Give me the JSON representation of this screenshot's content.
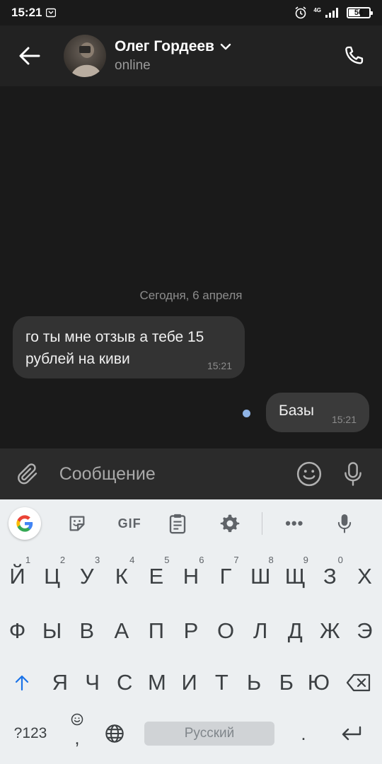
{
  "status_bar": {
    "time": "15:21",
    "network": "4G",
    "battery": "56",
    "battery_level": 0.56
  },
  "header": {
    "contact_name": "Олег Гордеев",
    "contact_status": "online"
  },
  "chat": {
    "date_separator": "Сегодня, 6 апреля",
    "messages": [
      {
        "direction": "incoming",
        "text": "го ты мне отзыв а тебе 15 рублей на киви",
        "time": "15:21"
      },
      {
        "direction": "outgoing",
        "text": "Базы",
        "time": "15:21",
        "read": false
      }
    ]
  },
  "composer": {
    "placeholder": "Сообщение"
  },
  "keyboard": {
    "toolbar": {
      "gif_label": "GIF",
      "more_label": "•••"
    },
    "rows": [
      [
        {
          "label": "Й",
          "hint": "1"
        },
        {
          "label": "Ц",
          "hint": "2"
        },
        {
          "label": "У",
          "hint": "3"
        },
        {
          "label": "К",
          "hint": "4"
        },
        {
          "label": "Е",
          "hint": "5"
        },
        {
          "label": "Н",
          "hint": "6"
        },
        {
          "label": "Г",
          "hint": "7"
        },
        {
          "label": "Ш",
          "hint": "8"
        },
        {
          "label": "Щ",
          "hint": "9"
        },
        {
          "label": "З",
          "hint": "0"
        },
        {
          "label": "Х",
          "hint": ""
        }
      ],
      [
        "Ф",
        "Ы",
        "В",
        "А",
        "П",
        "Р",
        "О",
        "Л",
        "Д",
        "Ж",
        "Э"
      ],
      [
        "Я",
        "Ч",
        "С",
        "М",
        "И",
        "Т",
        "Ь",
        "Б",
        "Ю"
      ]
    ],
    "symbols_key": "?123",
    "comma_key": ",",
    "space_label": "Русский",
    "period_key": "."
  },
  "colors": {
    "background": "#1a1a1a",
    "header": "#222222",
    "incoming_bubble": "#333333",
    "outgoing_bubble": "#3a3a3a",
    "unread_dot": "#8fb4e6",
    "keyboard_bg": "#eceff1",
    "shift_accent": "#1a73e8"
  }
}
